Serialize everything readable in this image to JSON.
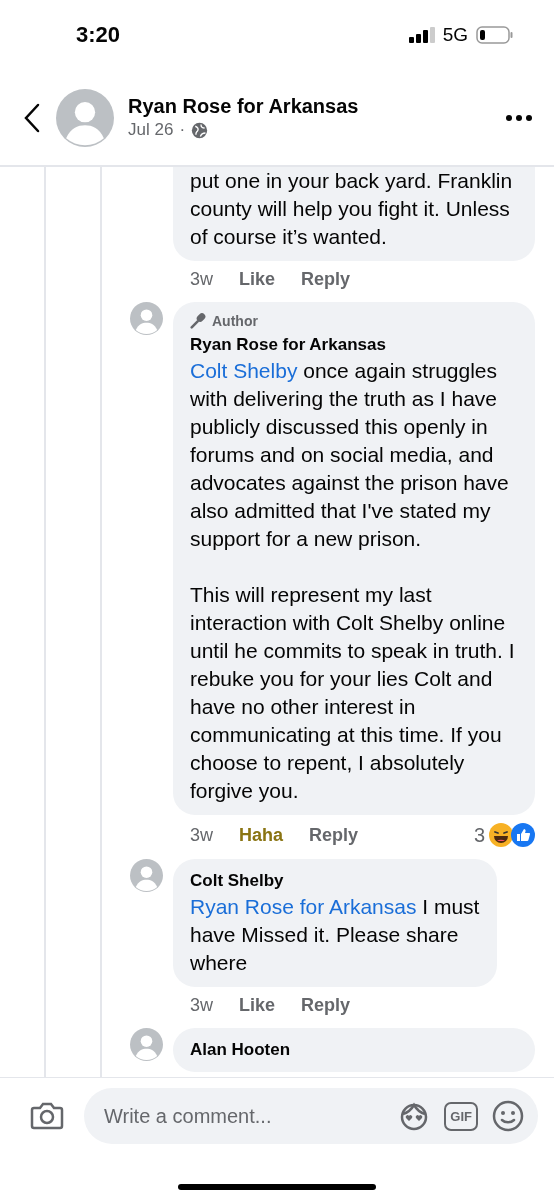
{
  "status_bar": {
    "time": "3:20",
    "network": "5G"
  },
  "header": {
    "page_name": "Ryan Rose for Arkansas",
    "date": "Jul 26",
    "separator": "·"
  },
  "comments": [
    {
      "paragraphs": [
        {
          "text": "put one in your back yard. Franklin county will help you fight it. Unless of course it’s wanted."
        }
      ],
      "time": "3w",
      "reaction_button": {
        "label": "Like",
        "selected": false
      },
      "reply": "Reply"
    },
    {
      "badge": "Author",
      "author": "Ryan Rose for Arkansas",
      "paragraphs": [
        {
          "mention": "Colt Shelby",
          "text": " once again struggles with delivering the truth as I have publicly discussed this openly in forums and on social media, and advocates against the prison have also admitted that I've stated my support for a new prison."
        },
        {
          "text": "This will represent my last interaction with Colt Shelby online until he commits to speak in truth. I rebuke you for your lies Colt and have no other interest in communicating at this time. If you choose to repent, I absolutely forgive you."
        }
      ],
      "time": "3w",
      "reaction_button": {
        "label": "Haha",
        "selected": true
      },
      "reply": "Reply",
      "reaction_count": "3"
    },
    {
      "author": "Colt Shelby",
      "paragraphs": [
        {
          "mention": "Ryan Rose for Arkansas",
          "text": " I must have Missed it. Please share where"
        }
      ],
      "time": "3w",
      "reaction_button": {
        "label": "Like",
        "selected": false
      },
      "reply": "Reply"
    },
    {
      "author": "Alan Hooten"
    }
  ],
  "composer": {
    "placeholder": "Write a comment...",
    "gif_label": "GIF"
  }
}
